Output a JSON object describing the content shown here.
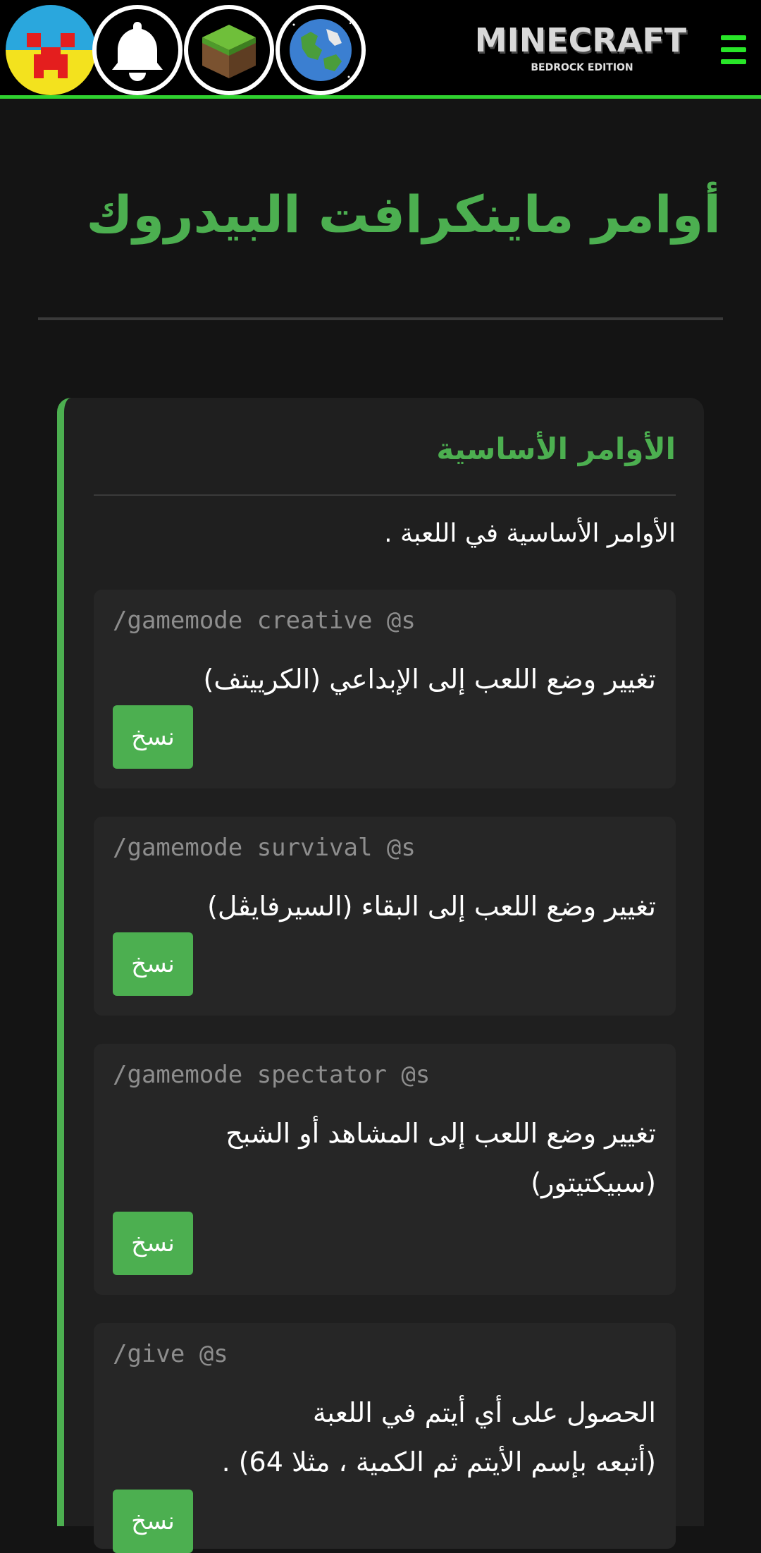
{
  "header": {
    "icons": [
      "creeper-icon",
      "bell-icon",
      "grass-block-icon",
      "earth-icon"
    ],
    "logo_text": "MINECRAFT",
    "logo_subtext": "BEDROCK EDITION",
    "accent_color": "#2fd12f"
  },
  "page": {
    "title": "أوامر ماينكرافت البيدروك",
    "title_color": "#4caf50"
  },
  "section": {
    "title": "الأوامر الأساسية",
    "description": "الأوامر الأساسية في اللعبة ."
  },
  "commands": [
    {
      "code": "/gamemode creative @s",
      "description": "تغيير وضع اللعب إلى الإبداعي (الكرييتف)",
      "button_label": "نسخ"
    },
    {
      "code": "/gamemode survival @s",
      "description": "تغيير وضع اللعب إلى البقاء (السيرفايڤل)",
      "button_label": "نسخ"
    },
    {
      "code": "/gamemode spectator @s",
      "description": "تغيير وضع اللعب إلى المشاهد أو الشبح (سبيكتيتور)",
      "button_label": "نسخ"
    },
    {
      "code": "/give @s",
      "description_line1": "الحصول على أي أيتم في اللعبة",
      "description_line2": "(أتبعه بإسم الأيتم ثم الكمية ، مثلا 64) .",
      "button_label": "نسخ"
    }
  ]
}
